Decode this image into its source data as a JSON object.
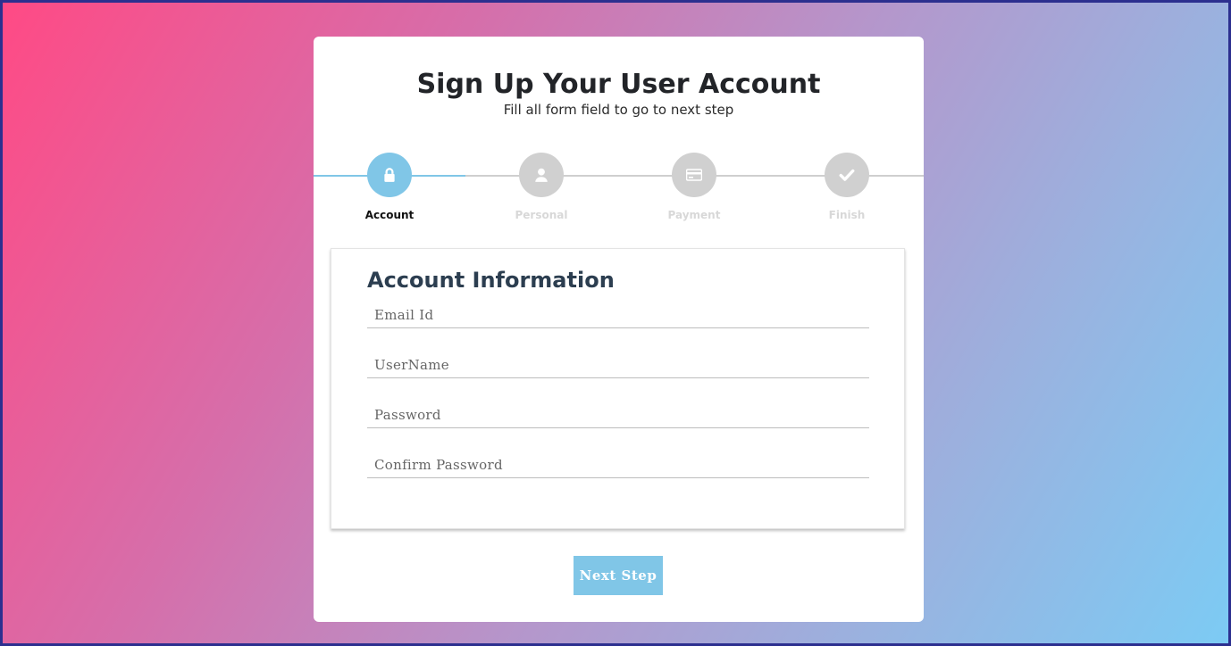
{
  "form": {
    "title": "Sign Up Your User Account",
    "subtitle": "Fill all form field to go to next step"
  },
  "steps": [
    {
      "label": "Account",
      "icon": "lock-icon",
      "active": true
    },
    {
      "label": "Personal",
      "icon": "user-icon",
      "active": false
    },
    {
      "label": "Payment",
      "icon": "credit-card-icon",
      "active": false
    },
    {
      "label": "Finish",
      "icon": "check-icon",
      "active": false
    }
  ],
  "account_section": {
    "title": "Account Information",
    "fields": [
      {
        "placeholder": "Email Id",
        "value": ""
      },
      {
        "placeholder": "UserName",
        "value": ""
      },
      {
        "placeholder": "Password",
        "value": ""
      },
      {
        "placeholder": "Confirm Password",
        "value": ""
      }
    ]
  },
  "actions": {
    "next_label": "Next Step"
  },
  "colors": {
    "accent": "#80c6e7",
    "inactive_step": "#d0d0d0",
    "gradient_start": "#ff4a85",
    "gradient_end": "#7ccbf4"
  }
}
